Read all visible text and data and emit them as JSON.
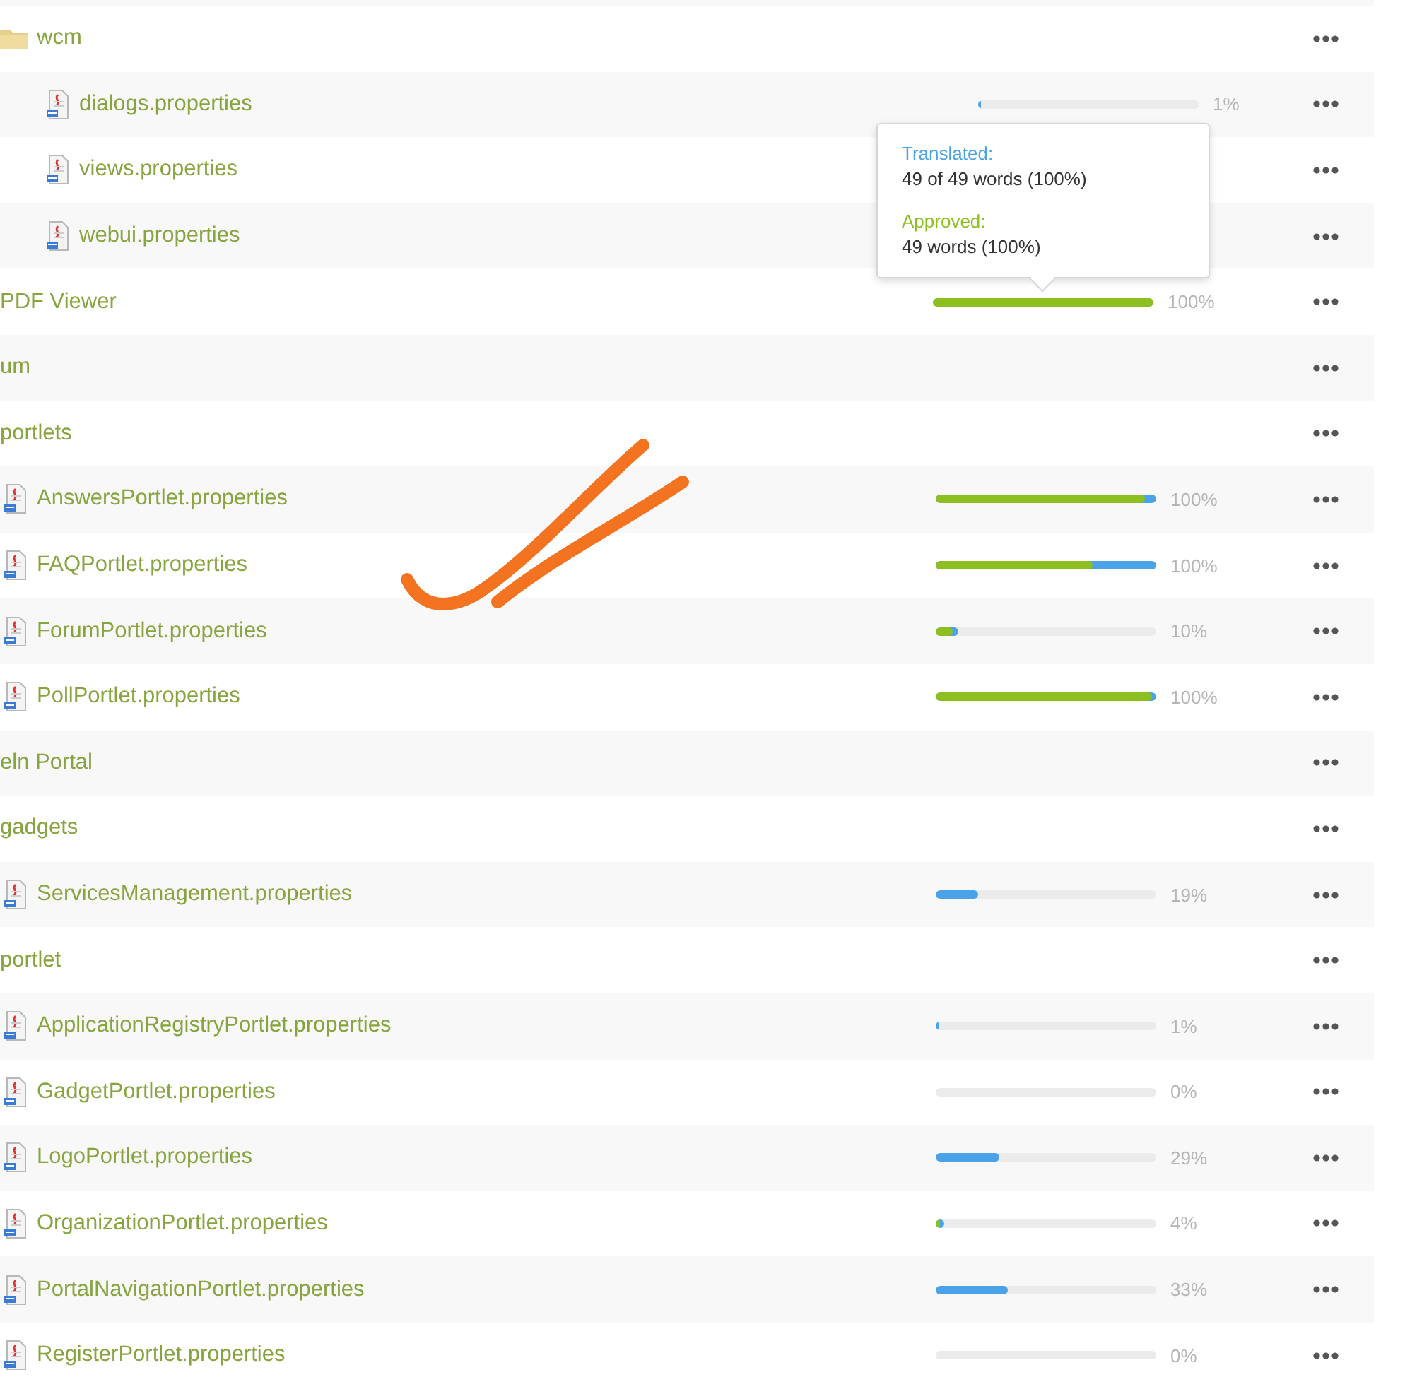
{
  "tree": [
    {
      "kind": "folder",
      "name": "wcm",
      "children": [
        {
          "kind": "file",
          "name": "dialogs.properties",
          "percent": "1%",
          "progress": [
            {
              "kind": "translated",
              "level": 0.01
            },
            {
              "kind": "approved",
              "level": 0
            }
          ]
        },
        {
          "kind": "file",
          "name": "views.properties"
        },
        {
          "kind": "file",
          "name": "webui.properties"
        }
      ]
    },
    {
      "kind": "section",
      "name": "PDF Viewer",
      "percent": "100%",
      "progress": [
        {
          "kind": "translated",
          "level": 1
        },
        {
          "kind": "approved",
          "level": 1
        }
      ]
    },
    {
      "kind": "section",
      "name": "um"
    },
    {
      "kind": "section",
      "name": "portlets",
      "children": [
        {
          "kind": "file",
          "name": "AnswersPortlet.properties",
          "percent": "100%",
          "progress": [
            {
              "kind": "translated",
              "level": 1
            },
            {
              "kind": "approved",
              "level": 0.95
            }
          ]
        },
        {
          "kind": "file",
          "name": "FAQPortlet.properties",
          "percent": "100%",
          "progress": [
            {
              "kind": "translated",
              "level": 1
            },
            {
              "kind": "approved",
              "level": 0.71
            }
          ]
        },
        {
          "kind": "file",
          "name": "ForumPortlet.properties",
          "percent": "10%",
          "progress": [
            {
              "kind": "translated",
              "level": 0.1
            },
            {
              "kind": "approved",
              "level": 0.08
            }
          ]
        },
        {
          "kind": "file",
          "name": "PollPortlet.properties",
          "percent": "100%",
          "progress": [
            {
              "kind": "translated",
              "level": 1
            },
            {
              "kind": "approved",
              "level": 0.98
            }
          ]
        }
      ]
    },
    {
      "kind": "section",
      "name": "eln Portal"
    },
    {
      "kind": "section",
      "name": "gadgets",
      "children": [
        {
          "kind": "file",
          "name": "ServicesManagement.properties",
          "percent": "19%",
          "progress": [
            {
              "kind": "translated",
              "level": 0.19
            },
            {
              "kind": "approved",
              "level": 0
            }
          ]
        }
      ]
    },
    {
      "kind": "section",
      "name": "portlet",
      "children": [
        {
          "kind": "file",
          "name": "ApplicationRegistryPortlet.properties",
          "percent": "1%",
          "progress": [
            {
              "kind": "translated",
              "level": 0.01
            },
            {
              "kind": "approved",
              "level": 0
            }
          ]
        },
        {
          "kind": "file",
          "name": "GadgetPortlet.properties",
          "percent": "0%",
          "progress": [
            {
              "kind": "translated",
              "level": 0
            },
            {
              "kind": "approved",
              "level": 0
            }
          ]
        },
        {
          "kind": "file",
          "name": "LogoPortlet.properties",
          "percent": "29%",
          "progress": [
            {
              "kind": "translated",
              "level": 0.29
            },
            {
              "kind": "approved",
              "level": 0
            }
          ]
        },
        {
          "kind": "file",
          "name": "OrganizationPortlet.properties",
          "percent": "4%",
          "progress": [
            {
              "kind": "translated",
              "level": 0.04
            },
            {
              "kind": "approved",
              "level": 0.02
            }
          ]
        },
        {
          "kind": "file",
          "name": "PortalNavigationPortlet.properties",
          "percent": "33%",
          "progress": [
            {
              "kind": "translated",
              "level": 0.33
            },
            {
              "kind": "approved",
              "level": 0
            }
          ]
        },
        {
          "kind": "file",
          "name": "RegisterPortlet.properties",
          "percent": "0%",
          "progress": [
            {
              "kind": "translated",
              "level": 0
            },
            {
              "kind": "approved",
              "level": 0
            }
          ]
        }
      ]
    }
  ],
  "tooltip": {
    "translated_label": "Translated:",
    "translated_value": "49 of 49 words (100%)",
    "approved_label": "Approved:",
    "approved_value": "49 words (100%)"
  }
}
